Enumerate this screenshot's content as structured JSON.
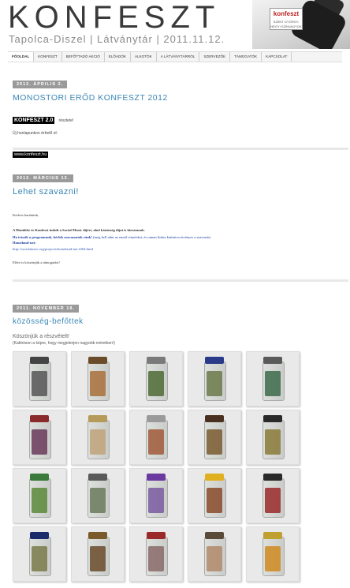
{
  "header": {
    "logo": "KONFESZT",
    "tagline": "Tapolca-Diszel | Látványtár | 2011.11.12.",
    "photo_label": "konfeszt",
    "photo_sub": "SZENT GYÖRGY-HEGYI SZÍNVAGYOK"
  },
  "nav": {
    "items": [
      "FŐOLDAL",
      "KONFESZT",
      "BEFŐTTADÓ AKCIÓ",
      "ELŐADÓK",
      "ALKOTÓK",
      "A LÁTVÁNYTÁRRÓL",
      "SZERVEZŐK",
      "TÁMOGATÓK",
      "KAPCSOLAT"
    ]
  },
  "posts": [
    {
      "date": "2012. ÁPRILIS 2.",
      "title": "MONOSTORI ERŐD KONFESZT 2012",
      "badge": "KONFESZT 2.0",
      "badge_suffix": "részlete!",
      "line": "Új honlapunkon érhető el:",
      "link": "www.konfeszt.hu"
    },
    {
      "date": "2012. MÁRCIUS 13.",
      "title": "Lehet szavazni!",
      "greeting": "Kedves barátaink,",
      "para1": "A Homlöke és Konfeszt indult a Social Music díjért, ahol közönség díjat is kiosztanak.",
      "para2_bold": "Ha tetszik a programunk, kérlek szavazzatok ránk!",
      "para2_rest": " (meg kell adni az email címeteket, és onnan linkre kattintva érvényes a szavazás)",
      "para3": "Homeland-net:",
      "url": "http://socialmusic.org/projects/homeland-net.2264.html",
      "thanks": "Előre is köszönjük a támogatást!"
    },
    {
      "date": "2011. NOVEMBER 18.",
      "title": "közösség-befőttek",
      "intro": "Köszönjük a részvételt!",
      "note": "(Kattintson a képre, hogy megjelenjen nagyobb méretben!)"
    }
  ],
  "gallery": {
    "rows": [
      [
        {
          "lid": "#444",
          "stuff": "#555"
        },
        {
          "lid": "#6a4c2a",
          "stuff": "#a8703a"
        },
        {
          "lid": "#7a7a7a",
          "stuff": "#4d6b35"
        },
        {
          "lid": "#2a3a8a",
          "stuff": "#6b7a4a"
        },
        {
          "lid": "#5a5a5a",
          "stuff": "#3d6b4a"
        }
      ],
      [
        {
          "lid": "#8a2a2a",
          "stuff": "#6a3a5a"
        },
        {
          "lid": "#b59a5a",
          "stuff": "#c0a27a"
        },
        {
          "lid": "#9a9a9a",
          "stuff": "#a05a3a"
        },
        {
          "lid": "#4a3020",
          "stuff": "#7a5a30"
        },
        {
          "lid": "#2a2a2a",
          "stuff": "#8a7a3a"
        }
      ],
      [
        {
          "lid": "#3a7a3a",
          "stuff": "#5a8a3a"
        },
        {
          "lid": "#5a5a5a",
          "stuff": "#6a7a5a"
        },
        {
          "lid": "#6a3aa0",
          "stuff": "#7a5aa0"
        },
        {
          "lid": "#e0b020",
          "stuff": "#8a4a2a"
        },
        {
          "lid": "#2a2a2a",
          "stuff": "#9a2a2a"
        }
      ],
      [
        {
          "lid": "#1a2a6a",
          "stuff": "#7a7a4a"
        },
        {
          "lid": "#7a5a2a",
          "stuff": "#6a4a2a"
        },
        {
          "lid": "#9a2a2a",
          "stuff": "#8a6a6a"
        },
        {
          "lid": "#5a4a3a",
          "stuff": "#b08a6a"
        },
        {
          "lid": "#c0a030",
          "stuff": "#d08a20"
        }
      ]
    ]
  }
}
